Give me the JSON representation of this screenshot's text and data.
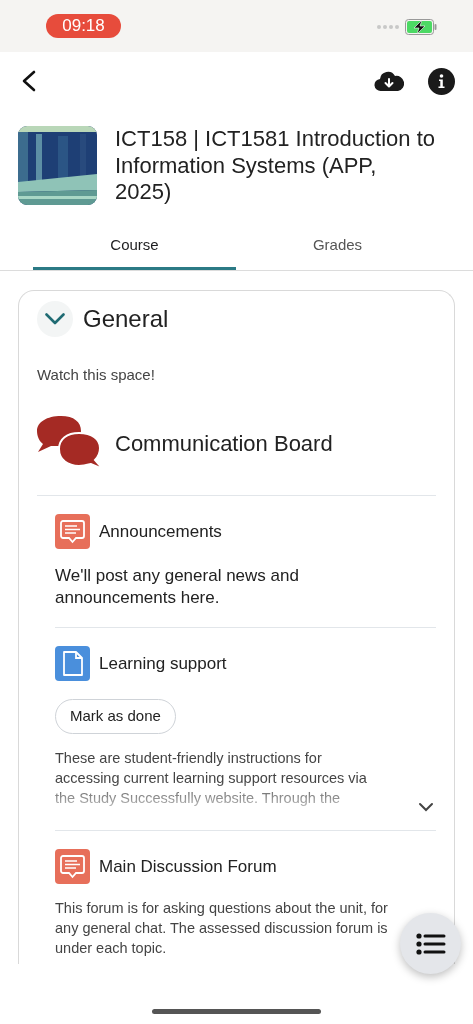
{
  "status_bar": {
    "time": "09:18",
    "charging": true
  },
  "course": {
    "title": "ICT158 | ICT1581 Introduction to Information Systems (APP, 2025)"
  },
  "tabs": [
    {
      "label": "Course",
      "selected": true
    },
    {
      "label": "Grades",
      "selected": false
    }
  ],
  "section": {
    "title": "General",
    "expanded": true,
    "summary": "Watch this space!",
    "banner": "Communication Board",
    "activities": [
      {
        "kind": "forum",
        "name": "Announcements",
        "description": {
          "kind": "intro",
          "text": "We'll post any general news and announcements here."
        }
      },
      {
        "kind": "page",
        "name": "Learning support",
        "button": "Mark as done",
        "description": {
          "kind": "summary",
          "text": "These are student-friendly instructions for accessing current learning support resources via the Study Successfully website.  Through the"
        },
        "collapsed": true
      },
      {
        "kind": "forum",
        "name": "Main Discussion Forum",
        "description": {
          "kind": "summary",
          "text": "This forum is for asking questions about the unit, for any general chat. The assessed discussion forum is under each topic."
        }
      }
    ]
  }
}
